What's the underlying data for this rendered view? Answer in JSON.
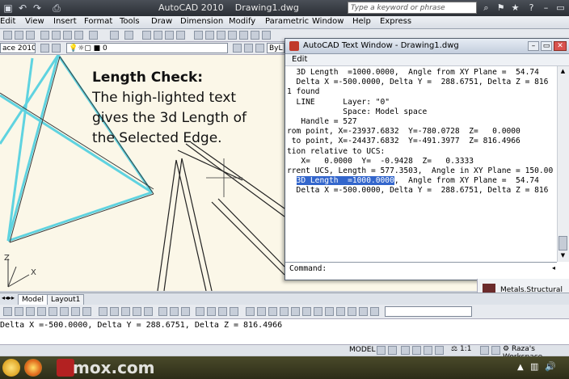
{
  "app": {
    "title": "AutoCAD 2010",
    "document": "Drawing1.dwg",
    "search_placeholder": "Type a keyword or phrase"
  },
  "menubar": [
    "Edit",
    "View",
    "Insert",
    "Format",
    "Tools",
    "Draw",
    "Dimension",
    "Modify",
    "Parametric",
    "Window",
    "Help",
    "Express"
  ],
  "toolbar2": {
    "workspace_value": "ace 2010",
    "layer_value": "0",
    "bylayer_value": "ByL"
  },
  "overlay": {
    "heading": "Length Check:",
    "lines": [
      "The high-lighted text",
      "gives the 3d Length of",
      "the Selected Edge."
    ]
  },
  "text_window": {
    "title": "AutoCAD Text Window - Drawing1.dwg",
    "menu": "Edit",
    "lines": [
      "  3D Length  =1000.0000,  Angle from XY Plane =  54.74",
      "  Delta X =-500.0000, Delta Y =  288.6751, Delta Z = 816",
      "",
      "",
      "",
      "1 found",
      "",
      "",
      "  LINE      Layer: \"0\"",
      "            Space: Model space",
      "   Handle = 527",
      "rom point, X=-23937.6832  Y=-780.0728  Z=   0.0000",
      " to point, X=-24437.6832  Y=-491.3977  Z= 816.4966",
      "tion relative to UCS:",
      "   X=   0.0000  Y=  -0.9428  Z=   0.3333",
      "rrent UCS, Length = 577.3503,  Angle in XY Plane = 150.00"
    ],
    "hl_pre": "  ",
    "hl_text": "3D Length  =1000.0000",
    "hl_post": ",  Angle from XY Plane =  54.74",
    "last_line": "  Delta X =-500.0000, Delta Y =  288.6751, Delta Z = 816",
    "command_prompt": "Command:"
  },
  "layout_tabs": [
    "Model",
    "Layout1"
  ],
  "command_line": "    Delta X =-500.0000, Delta Y =  288.6751, Delta Z = 816.4966",
  "tool_palette_item": "Metals.Structural ...",
  "status": {
    "model": "MODEL",
    "scale": "1:1",
    "workspace": "Raza's Workspace"
  },
  "watermark": "mox.com",
  "colors": {
    "highlight": "#3366cc",
    "selected_edge": "#5fd3e0",
    "canvas": "#fbf7e8"
  }
}
